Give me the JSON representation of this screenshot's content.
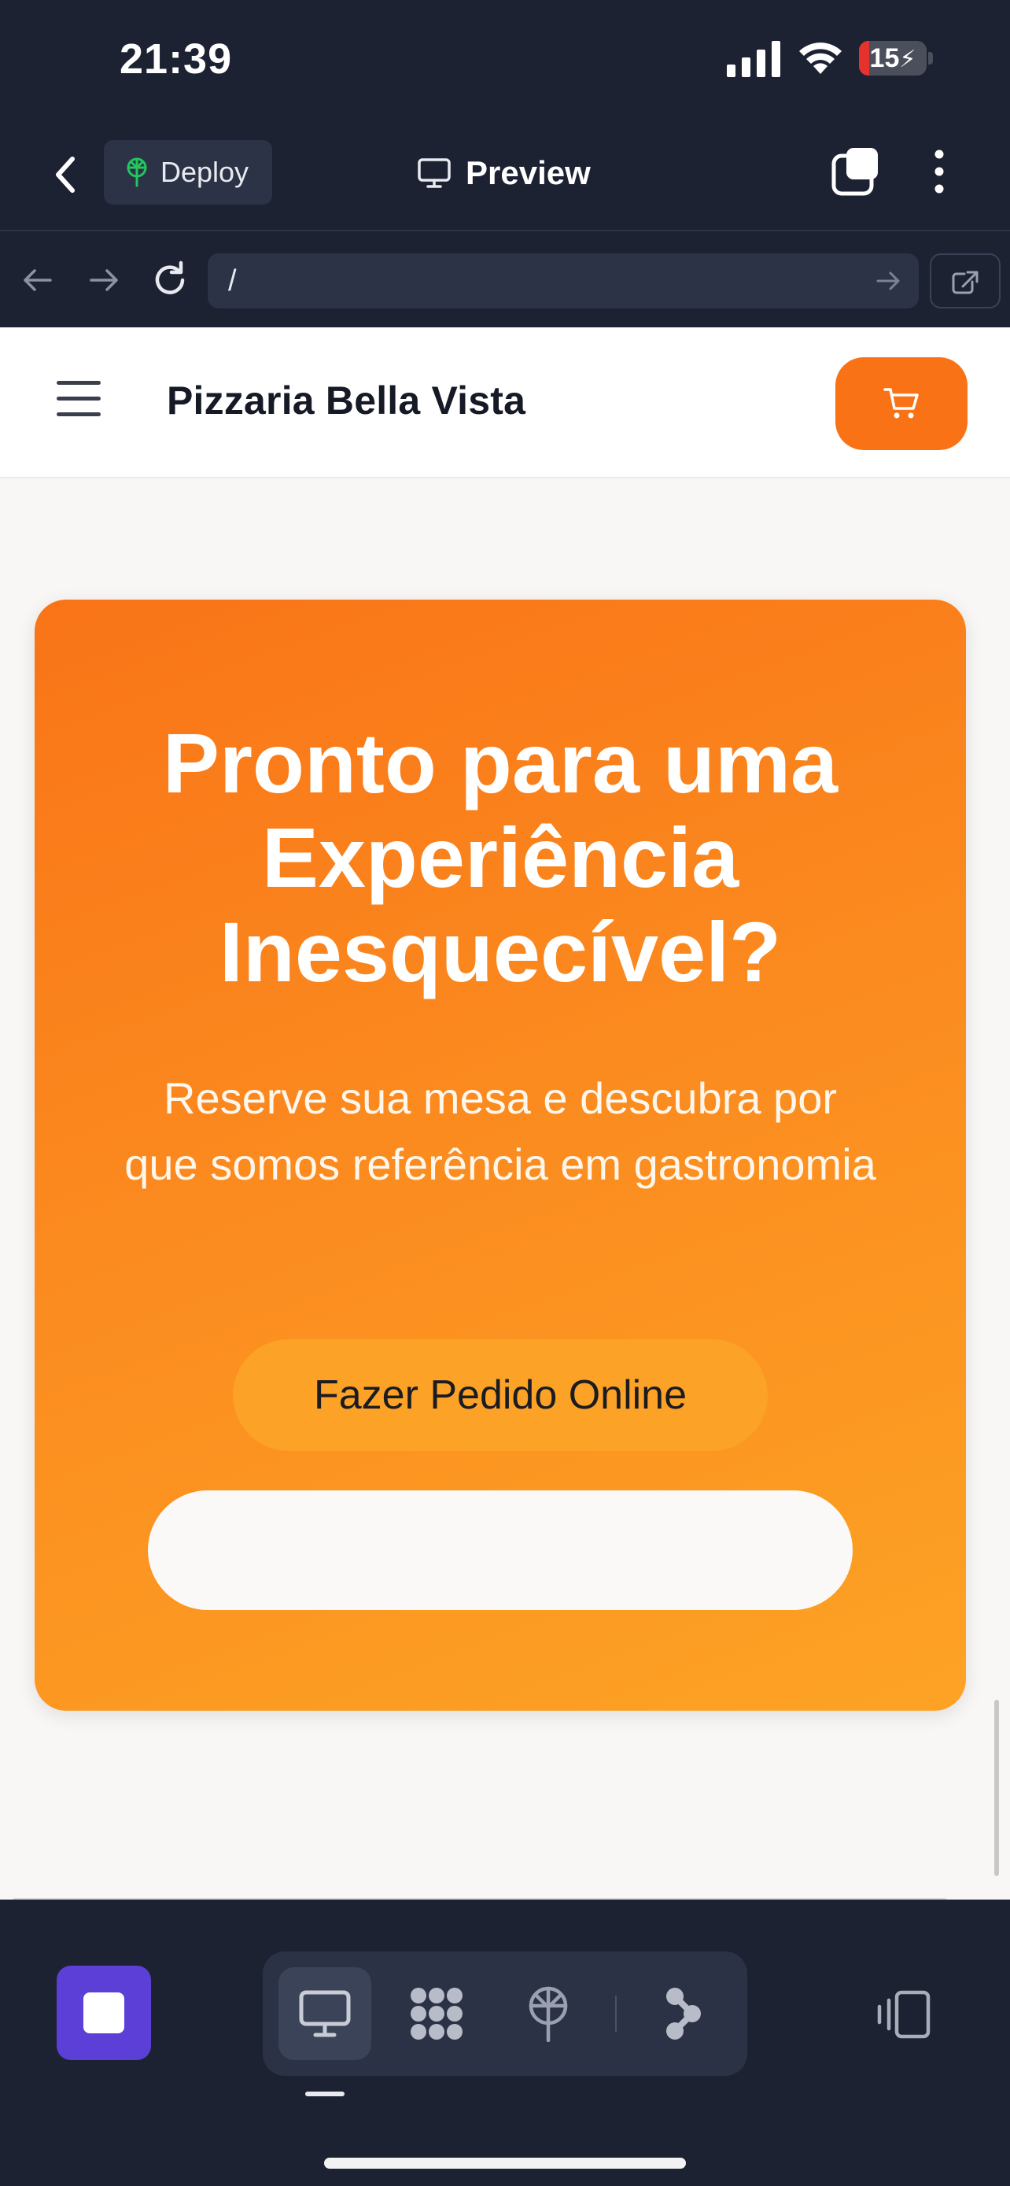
{
  "status_bar": {
    "time": "21:39",
    "battery": "15",
    "battery_level": 0.15
  },
  "toolbar": {
    "deploy_label": "Deploy",
    "preview_label": "Preview"
  },
  "url_bar": {
    "path": "/"
  },
  "site": {
    "title": "Pizzaria Bella Vista",
    "cta": {
      "title": "Pronto para uma Experiência Inesquecível?",
      "subtitle": "Reserve sua mesa e descubra por que somos referência em gastronomia",
      "order_button": "Fazer Pedido Online",
      "secondary_button": ""
    }
  },
  "colors": {
    "accent": "#f97316",
    "chrome": "#1d2233",
    "stop": "#5b3fd6"
  },
  "icons": [
    "chevron-left-icon",
    "deploy-icon",
    "monitor-icon",
    "tabs-icon",
    "more-vertical-icon",
    "arrow-left-icon",
    "arrow-right-icon",
    "reload-icon",
    "external-link-icon",
    "cart-icon",
    "monitor-icon",
    "apps-grid-icon",
    "deploy-icon",
    "branch-icon",
    "devices-icon"
  ]
}
